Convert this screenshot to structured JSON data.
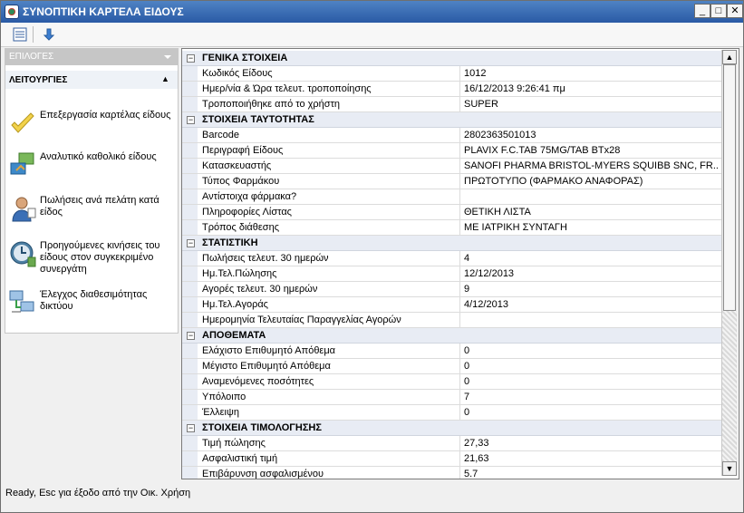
{
  "window": {
    "title": "ΣΥΝΟΠΤΙΚΗ ΚΑΡΤΕΛΑ ΕΙΔΟΥΣ",
    "controls": [
      "minimize",
      "maximize",
      "close"
    ]
  },
  "toolbar": {
    "buttons": [
      "list-icon",
      "arrow-down-icon"
    ]
  },
  "sidebar": {
    "options_header": "ΕΠΙΛΟΓΕΣ",
    "functions_header": "ΛΕΙΤΟΥΡΓΙΕΣ",
    "items": [
      {
        "label": "Επεξεργασία καρτέλας είδους",
        "icon": "pencil-check-icon"
      },
      {
        "label": "Αναλυτικό καθολικό είδους",
        "icon": "boxes-icon"
      },
      {
        "label": "Πωλήσεις ανά πελάτη κατά\nείδος",
        "icon": "customer-icon"
      },
      {
        "label": "Προηγούμενες κινήσεις του\nείδους στον συγκεκριμένο\nσυνεργάτη",
        "icon": "clock-icon"
      },
      {
        "label": "Έλεγχος διαθεσιμότητας\nδικτύου",
        "icon": "network-icon"
      }
    ]
  },
  "grid": {
    "sections": [
      {
        "title": "ΓΕΝΙΚΑ ΣΤΟΙΧΕΙΑ",
        "rows": [
          {
            "prop": "Κωδικός Είδους",
            "val": "1012"
          },
          {
            "prop": "Ημερ/νία & Ώρα τελευτ. τροποποίησης",
            "val": "16/12/2013 9:26:41 πμ"
          },
          {
            "prop": "Τροποποιήθηκε από το χρήστη",
            "val": "SUPER"
          }
        ]
      },
      {
        "title": "ΣΤΟΙΧΕΙΑ ΤΑΥΤΟΤΗΤΑΣ",
        "rows": [
          {
            "prop": "Barcode",
            "val": "2802363501013"
          },
          {
            "prop": "Περιγραφή Είδους",
            "val": "PLAVIX F.C.TAB 75MG/TAB BTx28"
          },
          {
            "prop": "Κατασκευαστής",
            "val": "SANOFI PHARMA BRISTOL-MYERS SQUIBB SNC, FR..."
          },
          {
            "prop": "Τύπος Φαρμάκου",
            "val": "ΠΡΩΤΟΤΥΠΟ (ΦΑΡΜΑΚΟ ΑΝΑΦΟΡΑΣ)"
          },
          {
            "prop": "Αντίστοιχα φάρμακα?",
            "val": ""
          },
          {
            "prop": "Πληροφορίες Λίστας",
            "val": "ΘΕΤΙΚΗ ΛΙΣΤΑ"
          },
          {
            "prop": "Τρόπος διάθεσης",
            "val": "ΜΕ ΙΑΤΡΙΚΗ ΣΥΝΤΑΓΗ"
          }
        ]
      },
      {
        "title": "ΣΤΑΤΙΣΤΙΚΗ",
        "rows": [
          {
            "prop": "Πωλήσεις τελευτ. 30 ημερών",
            "val": "4"
          },
          {
            "prop": "Ημ.Τελ.Πώλησης",
            "val": "12/12/2013"
          },
          {
            "prop": "Αγορές τελευτ. 30 ημερών",
            "val": "9"
          },
          {
            "prop": "Ημ.Τελ.Αγοράς",
            "val": "4/12/2013"
          },
          {
            "prop": "Ημερομηνία Τελευταίας Παραγγελίας Αγορών",
            "val": ""
          }
        ]
      },
      {
        "title": "ΑΠΟΘΕΜΑΤΑ",
        "rows": [
          {
            "prop": "Ελάχιστο Επιθυμητό Απόθεμα",
            "val": "0"
          },
          {
            "prop": "Μέγιστο Επιθυμητό Απόθεμα",
            "val": "0"
          },
          {
            "prop": "Αναμενόμενες ποσότητες",
            "val": "0"
          },
          {
            "prop": "Υπόλοιπο",
            "val": "7"
          },
          {
            "prop": "Έλλειψη",
            "val": "0"
          }
        ]
      },
      {
        "title": "ΣΤΟΙΧΕΙΑ ΤΙΜΟΛΟΓΗΣΗΣ",
        "rows": [
          {
            "prop": "Τιμή πώλησης",
            "val": "27,33"
          },
          {
            "prop": "Ασφαλιστική τιμή",
            "val": "21,63"
          },
          {
            "prop": "Επιβάρυνση ασφαλισμένου",
            "val": "5.7"
          }
        ]
      }
    ]
  },
  "statusbar": {
    "text": "Ready, Esc για έξοδο από την Οικ. Χρήση"
  }
}
